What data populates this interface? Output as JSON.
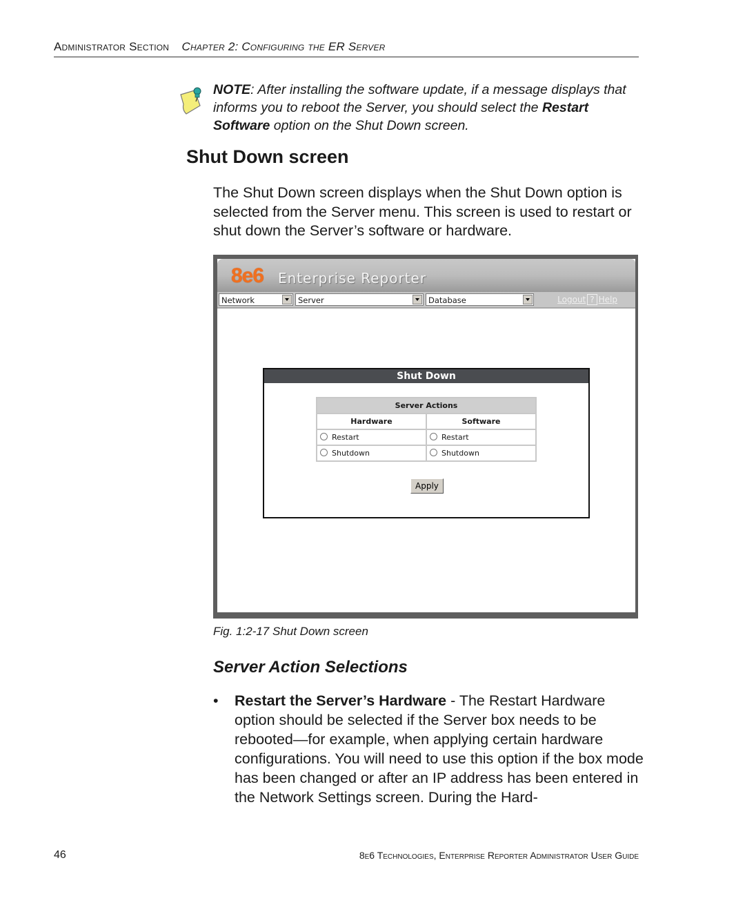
{
  "running_header": {
    "section": "Administrator Section",
    "chapter": "Chapter 2: Configuring the ER Server"
  },
  "note": {
    "icon": "note-pushpin-icon",
    "label": "NOTE",
    "text_before": ": After installing the software update, if a message displays that informs you to reboot the Server, you should select the ",
    "bold_term": "Restart Software",
    "text_after": " option on the Shut Down screen."
  },
  "section_heading": "Shut Down screen",
  "intro_paragraph": "The Shut Down screen displays when the Shut Down option is selected from the Server menu. This screen is used to restart or shut down the Server’s software or hardware.",
  "screenshot": {
    "logo": "8e6",
    "app_name": "Enterprise Reporter",
    "menus": [
      {
        "label": "Network"
      },
      {
        "label": "Server"
      },
      {
        "label": "Database"
      }
    ],
    "logout_link": "Logout",
    "help_icon": "?",
    "help_link": "Help",
    "panel_title": "Shut Down",
    "table_title": "Server Actions",
    "columns": [
      "Hardware",
      "Software"
    ],
    "rows": [
      [
        "Restart",
        "Restart"
      ],
      [
        "Shutdown",
        "Shutdown"
      ]
    ],
    "apply_label": "Apply"
  },
  "figure_caption": "Fig. 1:2-17  Shut Down screen",
  "subsection_heading": "Server Action Selections",
  "bullet": {
    "symbol": "•",
    "bold_lead": "Restart the Server’s Hardware",
    "text": " - The Restart Hardware option should be selected if the Server box needs to be rebooted—for example, when applying certain hardware configurations. You will need to use this option if the box mode has been changed or after an IP address has been entered in the Network Settings screen. During the Hard-"
  },
  "footer": {
    "page_number": "46",
    "book_title": "8e6 Technologies, Enterprise Reporter Administrator User Guide"
  }
}
